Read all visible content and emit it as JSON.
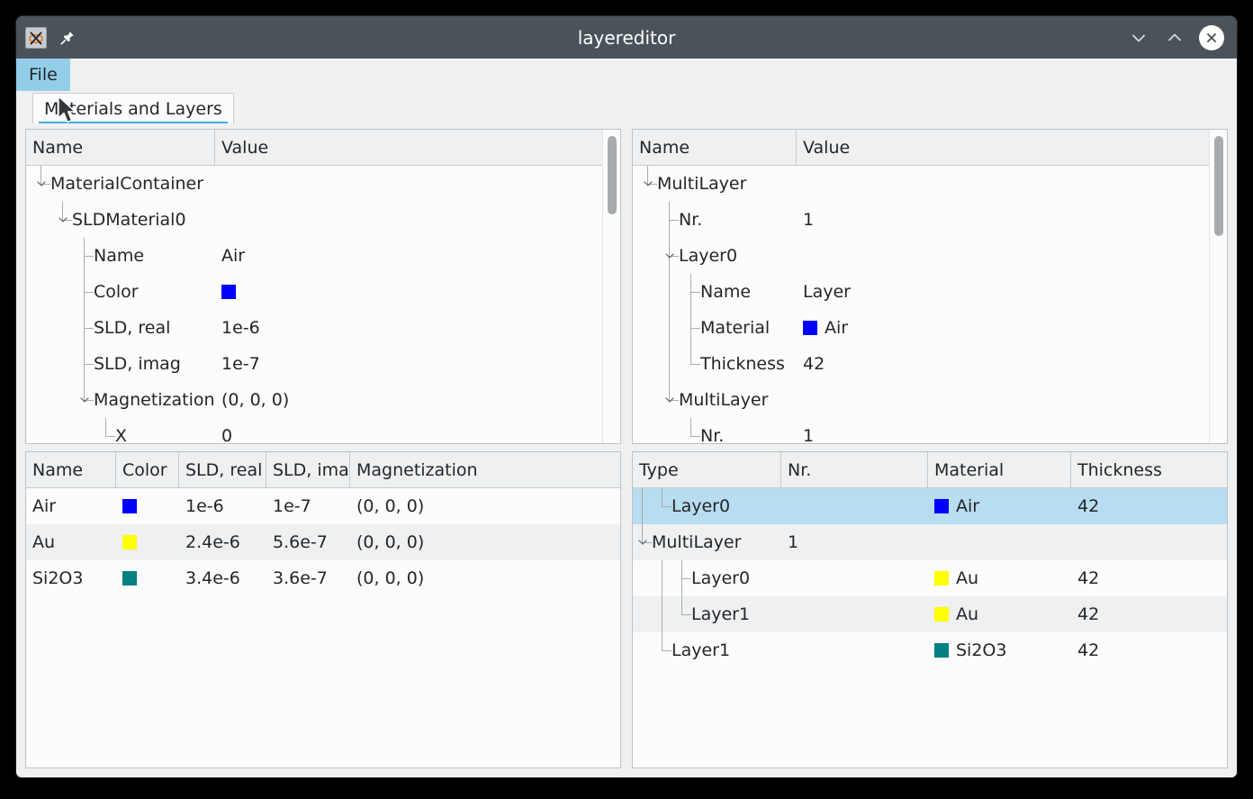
{
  "window": {
    "title": "layereditor",
    "icon": "app-icon",
    "pin_icon": "pin-icon",
    "minimize_icon": "chevron-down-icon",
    "maximize_icon": "chevron-up-icon",
    "close_icon": "close-icon"
  },
  "menubar": {
    "items": [
      {
        "label": "File",
        "active": true
      }
    ]
  },
  "tabs": [
    {
      "label": "Materials and Layers",
      "selected": true
    }
  ],
  "colors": {
    "accent": "#3daee9",
    "menu_highlight": "#93cee9",
    "selection": "#b8dcf0",
    "titlebar": "#4a525a",
    "air": "#0000ff",
    "au": "#ffff00",
    "si2o3": "#008080"
  },
  "material_tree": {
    "headers": [
      "Name",
      "Value"
    ],
    "rows": [
      {
        "depth": 0,
        "expander": "chevron-down-icon",
        "name": "MaterialContainer",
        "value": ""
      },
      {
        "depth": 1,
        "expander": "chevron-down-icon",
        "name": "SLDMaterial0",
        "value": ""
      },
      {
        "depth": 2,
        "expander": "",
        "name": "Name",
        "value": "Air"
      },
      {
        "depth": 2,
        "expander": "",
        "name": "Color",
        "value": "",
        "swatch": "#0000ff"
      },
      {
        "depth": 2,
        "expander": "",
        "name": "SLD, real",
        "value": "1e-6"
      },
      {
        "depth": 2,
        "expander": "",
        "name": "SLD, imag",
        "value": "1e-7"
      },
      {
        "depth": 2,
        "expander": "chevron-down-icon",
        "name": "Magnetization",
        "value": "(0, 0, 0)"
      },
      {
        "depth": 3,
        "expander": "",
        "name": "X",
        "value": "0"
      }
    ],
    "scroll_thumb": {
      "top_pct": 2,
      "height_pct": 25
    }
  },
  "layer_tree": {
    "headers": [
      "Name",
      "Value"
    ],
    "rows": [
      {
        "depth": 0,
        "expander": "chevron-down-icon",
        "name": "MultiLayer",
        "value": ""
      },
      {
        "depth": 1,
        "expander": "",
        "name": "Nr.",
        "value": "1"
      },
      {
        "depth": 1,
        "expander": "chevron-down-icon",
        "name": "Layer0",
        "value": ""
      },
      {
        "depth": 2,
        "expander": "",
        "name": "Name",
        "value": "Layer"
      },
      {
        "depth": 2,
        "expander": "",
        "name": "Material",
        "value": "Air",
        "swatch": "#0000ff"
      },
      {
        "depth": 2,
        "expander": "",
        "name": "Thickness",
        "value": "42"
      },
      {
        "depth": 1,
        "expander": "chevron-down-icon",
        "name": "MultiLayer",
        "value": ""
      },
      {
        "depth": 2,
        "expander": "",
        "name": "Nr.",
        "value": "1"
      }
    ],
    "scroll_thumb": {
      "top_pct": 2,
      "height_pct": 32
    }
  },
  "material_table": {
    "headers": [
      "Name",
      "Color",
      "SLD, real",
      "SLD, imag",
      "Magnetization"
    ],
    "rows": [
      {
        "name": "Air",
        "swatch": "#0000ff",
        "sld_real": "1e-6",
        "sld_imag": "1e-7",
        "magnetization": "(0, 0, 0)"
      },
      {
        "name": "Au",
        "swatch": "#ffff00",
        "sld_real": "2.4e-6",
        "sld_imag": "5.6e-7",
        "magnetization": "(0, 0, 0)"
      },
      {
        "name": "Si2O3",
        "swatch": "#008080",
        "sld_real": "3.4e-6",
        "sld_imag": "3.6e-7",
        "magnetization": "(0, 0, 0)"
      }
    ]
  },
  "layer_table": {
    "headers": [
      "Type",
      "Nr.",
      "Material",
      "Thickness"
    ],
    "rows": [
      {
        "depth": 1,
        "expander": "",
        "type": "Layer0",
        "nr": "",
        "material": "Air",
        "swatch": "#0000ff",
        "thickness": "42",
        "selected": true,
        "alt": false
      },
      {
        "depth": 0,
        "expander": "chevron-down-icon",
        "type": "MultiLayer",
        "nr": "1",
        "material": "",
        "swatch": "",
        "thickness": "",
        "selected": false,
        "alt": true
      },
      {
        "depth": 2,
        "expander": "",
        "type": "Layer0",
        "nr": "",
        "material": "Au",
        "swatch": "#ffff00",
        "thickness": "42",
        "selected": false,
        "alt": false
      },
      {
        "depth": 2,
        "expander": "",
        "type": "Layer1",
        "nr": "",
        "material": "Au",
        "swatch": "#ffff00",
        "thickness": "42",
        "selected": false,
        "alt": true
      },
      {
        "depth": 1,
        "expander": "",
        "type": "Layer1",
        "nr": "",
        "material": "Si2O3",
        "swatch": "#008080",
        "thickness": "42",
        "selected": false,
        "alt": false
      }
    ]
  }
}
